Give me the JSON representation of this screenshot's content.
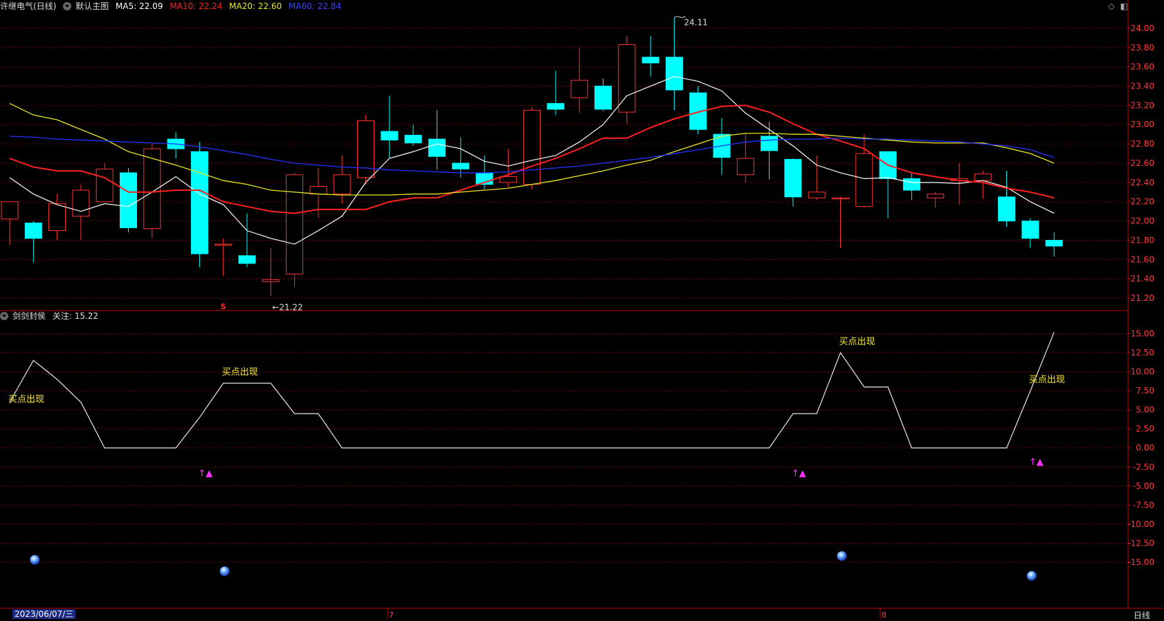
{
  "header": {
    "stock": "许继电气(日线)",
    "main_chart": "默认主图",
    "ma5": "MA5: 22.09",
    "ma10": "MA10: 22.24",
    "ma20": "MA20: 22.60",
    "ma60": "MA60: 22.84"
  },
  "indicator_header": {
    "name": "剑剑封侯",
    "focus": "关注: 15.22"
  },
  "footer": {
    "date": "2023/06/07/三",
    "period": "日线",
    "month_marks": [
      "7",
      "8"
    ]
  },
  "colors": {
    "up": "#ff3333",
    "down": "#00ffff",
    "ma5": "#ffffff",
    "ma10": "#ff2020",
    "ma20": "#e8e820",
    "ma60": "#2233ff",
    "grid": "#7a0000",
    "axis": "#cc0000"
  },
  "chart_data": [
    {
      "type": "candlestick",
      "title": "许继电气(日线)",
      "ylim": [
        21.1,
        24.15
      ],
      "yticks": [
        21.2,
        21.4,
        21.6,
        21.8,
        22.0,
        22.2,
        22.4,
        22.6,
        22.8,
        23.0,
        23.2,
        23.4,
        23.6,
        23.8,
        24.0
      ],
      "annotations": {
        "high": "24.11",
        "low": "←21.22",
        "marker": "S"
      },
      "candles": [
        {
          "o": 22.02,
          "h": 22.2,
          "l": 21.75,
          "c": 22.2
        },
        {
          "o": 21.98,
          "h": 22.0,
          "l": 21.57,
          "c": 21.82
        },
        {
          "o": 21.9,
          "h": 22.28,
          "l": 21.8,
          "c": 22.18
        },
        {
          "o": 22.05,
          "h": 22.38,
          "l": 21.8,
          "c": 22.32
        },
        {
          "o": 22.2,
          "h": 22.6,
          "l": 22.2,
          "c": 22.54
        },
        {
          "o": 22.5,
          "h": 22.55,
          "l": 21.88,
          "c": 21.93
        },
        {
          "o": 21.92,
          "h": 22.8,
          "l": 21.82,
          "c": 22.75
        },
        {
          "o": 22.85,
          "h": 22.92,
          "l": 22.65,
          "c": 22.75
        },
        {
          "o": 22.72,
          "h": 22.82,
          "l": 21.52,
          "c": 21.66
        },
        {
          "o": 21.76,
          "h": 21.82,
          "l": 21.43,
          "c": 21.76
        },
        {
          "o": 21.64,
          "h": 22.08,
          "l": 21.52,
          "c": 21.56
        },
        {
          "o": 21.37,
          "h": 21.72,
          "l": 21.22,
          "c": 21.39
        },
        {
          "o": 21.45,
          "h": 22.5,
          "l": 21.32,
          "c": 22.48
        },
        {
          "o": 22.28,
          "h": 22.55,
          "l": 22.03,
          "c": 22.36
        },
        {
          "o": 22.28,
          "h": 22.68,
          "l": 22.18,
          "c": 22.48
        },
        {
          "o": 22.45,
          "h": 23.1,
          "l": 22.38,
          "c": 23.04
        },
        {
          "o": 22.93,
          "h": 23.3,
          "l": 22.65,
          "c": 22.84
        },
        {
          "o": 22.89,
          "h": 23.0,
          "l": 22.78,
          "c": 22.81
        },
        {
          "o": 22.85,
          "h": 23.15,
          "l": 22.53,
          "c": 22.67
        },
        {
          "o": 22.6,
          "h": 22.87,
          "l": 22.45,
          "c": 22.54
        },
        {
          "o": 22.5,
          "h": 22.68,
          "l": 22.33,
          "c": 22.38
        },
        {
          "o": 22.4,
          "h": 22.75,
          "l": 22.35,
          "c": 22.46
        },
        {
          "o": 22.38,
          "h": 23.18,
          "l": 22.33,
          "c": 23.15
        },
        {
          "o": 23.22,
          "h": 23.56,
          "l": 23.1,
          "c": 23.16
        },
        {
          "o": 23.28,
          "h": 23.8,
          "l": 23.12,
          "c": 23.46
        },
        {
          "o": 23.4,
          "h": 23.48,
          "l": 23.14,
          "c": 23.16
        },
        {
          "o": 23.13,
          "h": 23.92,
          "l": 23.01,
          "c": 23.83
        },
        {
          "o": 23.7,
          "h": 23.92,
          "l": 23.5,
          "c": 23.64
        },
        {
          "o": 23.7,
          "h": 24.11,
          "l": 23.15,
          "c": 23.36
        },
        {
          "o": 23.33,
          "h": 23.4,
          "l": 22.9,
          "c": 22.95
        },
        {
          "o": 22.9,
          "h": 23.07,
          "l": 22.48,
          "c": 22.66
        },
        {
          "o": 22.48,
          "h": 22.91,
          "l": 22.4,
          "c": 22.65
        },
        {
          "o": 22.88,
          "h": 23.03,
          "l": 22.43,
          "c": 22.73
        },
        {
          "o": 22.64,
          "h": 22.65,
          "l": 22.15,
          "c": 22.25
        },
        {
          "o": 22.24,
          "h": 22.68,
          "l": 22.22,
          "c": 22.3
        },
        {
          "o": 22.23,
          "h": 22.25,
          "l": 21.72,
          "c": 22.24
        },
        {
          "o": 22.15,
          "h": 22.9,
          "l": 22.14,
          "c": 22.7
        },
        {
          "o": 22.72,
          "h": 22.72,
          "l": 22.03,
          "c": 22.44
        },
        {
          "o": 22.44,
          "h": 22.5,
          "l": 22.22,
          "c": 22.32
        },
        {
          "o": 22.24,
          "h": 22.3,
          "l": 22.14,
          "c": 22.28
        },
        {
          "o": 22.42,
          "h": 22.6,
          "l": 22.17,
          "c": 22.44
        },
        {
          "o": 22.42,
          "h": 22.52,
          "l": 22.23,
          "c": 22.49
        },
        {
          "o": 22.25,
          "h": 22.52,
          "l": 21.94,
          "c": 22.0
        },
        {
          "o": 22.0,
          "h": 22.03,
          "l": 21.72,
          "c": 21.82
        },
        {
          "o": 21.8,
          "h": 21.88,
          "l": 21.63,
          "c": 21.74
        }
      ],
      "ma5": [
        22.45,
        22.28,
        22.17,
        22.1,
        22.18,
        22.15,
        22.3,
        22.46,
        22.28,
        22.17,
        21.9,
        21.82,
        21.76,
        21.9,
        22.05,
        22.4,
        22.65,
        22.72,
        22.8,
        22.75,
        22.62,
        22.57,
        22.63,
        22.68,
        22.82,
        23.0,
        23.3,
        23.4,
        23.5,
        23.45,
        23.35,
        23.12,
        22.95,
        22.78,
        22.58,
        22.5,
        22.44,
        22.45,
        22.4,
        22.4,
        22.39,
        22.42,
        22.35,
        22.2,
        22.08
      ],
      "ma10": [
        22.65,
        22.56,
        22.52,
        22.52,
        22.45,
        22.3,
        22.3,
        22.32,
        22.32,
        22.2,
        22.15,
        22.1,
        22.08,
        22.12,
        22.12,
        22.12,
        22.2,
        22.24,
        22.24,
        22.32,
        22.4,
        22.48,
        22.57,
        22.65,
        22.75,
        22.86,
        22.86,
        22.97,
        23.06,
        23.13,
        23.19,
        23.2,
        23.13,
        23.01,
        22.9,
        22.83,
        22.75,
        22.58,
        22.5,
        22.46,
        22.42,
        22.4,
        22.34,
        22.3,
        22.24
      ],
      "ma20": [
        23.22,
        23.1,
        23.05,
        22.95,
        22.85,
        22.72,
        22.65,
        22.58,
        22.5,
        22.42,
        22.38,
        22.32,
        22.3,
        22.28,
        22.27,
        22.27,
        22.27,
        22.28,
        22.28,
        22.3,
        22.32,
        22.34,
        22.38,
        22.42,
        22.47,
        22.52,
        22.58,
        22.63,
        22.72,
        22.8,
        22.88,
        22.91,
        22.91,
        22.9,
        22.9,
        22.88,
        22.86,
        22.84,
        22.82,
        22.81,
        22.81,
        22.81,
        22.76,
        22.7,
        22.6
      ],
      "ma60": [
        22.88,
        22.87,
        22.85,
        22.84,
        22.83,
        22.82,
        22.81,
        22.8,
        22.77,
        22.73,
        22.69,
        22.64,
        22.6,
        22.58,
        22.56,
        22.55,
        22.53,
        22.52,
        22.51,
        22.5,
        22.5,
        22.51,
        22.53,
        22.55,
        22.57,
        22.6,
        22.63,
        22.66,
        22.7,
        22.74,
        22.78,
        22.82,
        22.84,
        22.85,
        22.85,
        22.86,
        22.85,
        22.85,
        22.84,
        22.83,
        22.82,
        22.8,
        22.78,
        22.74,
        22.66
      ]
    },
    {
      "type": "line",
      "title": "剑剑封侯",
      "ylim": [
        -21,
        16.5
      ],
      "yticks": [
        15,
        12.5,
        10,
        7.5,
        5,
        2.5,
        0,
        -2.5,
        -5,
        -7.5,
        -10,
        -12.5,
        -15
      ],
      "values": [
        6,
        11.5,
        9,
        6,
        0,
        0,
        0,
        0,
        4,
        8.5,
        8.5,
        8.5,
        4.5,
        4.5,
        0,
        0,
        0,
        0,
        0,
        0,
        0,
        0,
        0,
        0,
        0,
        0,
        0,
        0,
        0,
        0,
        0,
        0,
        0,
        4.5,
        4.5,
        12.5,
        8,
        8,
        0,
        0,
        0,
        0,
        0,
        7.5,
        15.2
      ],
      "signal_label": "买点出现",
      "signals": [
        0,
        9,
        35,
        43
      ],
      "arrow_label": "↑▲",
      "arrows": [
        {
          "x": 8,
          "y": -3.7
        },
        {
          "x": 33,
          "y": -3.7
        },
        {
          "x": 43,
          "y": -2.2
        }
      ],
      "balls": [
        {
          "x": 1,
          "y": -14.7
        },
        {
          "x": 9,
          "y": -16.2
        },
        {
          "x": 35,
          "y": -14.2
        },
        {
          "x": 43,
          "y": -16.8
        }
      ]
    }
  ]
}
